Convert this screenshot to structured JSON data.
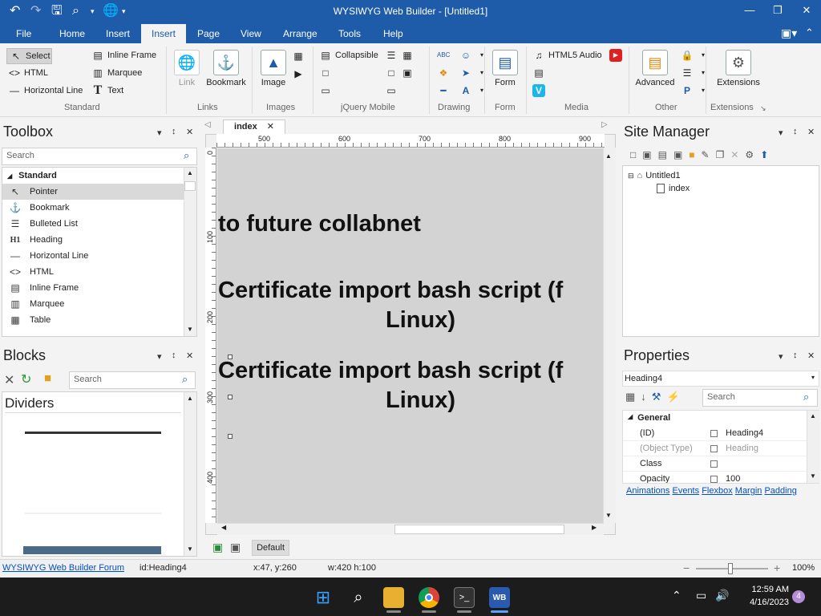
{
  "window": {
    "title": "WYSIWYG Web Builder - [Untitled1]"
  },
  "menu": [
    "File",
    "Home",
    "Insert",
    "Insert",
    "Page",
    "View",
    "Arrange",
    "Tools",
    "Help"
  ],
  "menu_tabs": {
    "file": "File",
    "home": "Home",
    "insert1": "Insert",
    "insert2": "Insert",
    "page": "Page",
    "view": "View",
    "arrange": "Arrange",
    "tools": "Tools",
    "help": "Help"
  },
  "ribbon": {
    "standard": {
      "select": "Select",
      "html": "HTML",
      "hline": "Horizontal Line",
      "iframe": "Inline Frame",
      "marquee": "Marquee",
      "text": "Text",
      "group": "Standard"
    },
    "links": {
      "link": "Link",
      "bookmark": "Bookmark",
      "group": "Links"
    },
    "images": {
      "image": "Image",
      "group": "Images"
    },
    "jquery": {
      "collapsible": "Collapsible",
      "group": "jQuery Mobile"
    },
    "drawing": {
      "group": "Drawing"
    },
    "form": {
      "form": "Form",
      "group": "Form"
    },
    "media": {
      "audio": "HTML5 Audio",
      "group": "Media"
    },
    "other": {
      "advanced": "Advanced",
      "group": "Other"
    },
    "extensions": {
      "extensions": "Extensions",
      "group": "Extensions"
    }
  },
  "toolbox": {
    "title": "Toolbox",
    "search_placeholder": "Search",
    "section": "Standard",
    "items": [
      {
        "icon": "pointer-icon",
        "glyph": "↖",
        "label": "Pointer"
      },
      {
        "icon": "anchor-icon",
        "glyph": "⚓",
        "label": "Bookmark"
      },
      {
        "icon": "bulleted-list-icon",
        "glyph": "☰",
        "label": "Bulleted List"
      },
      {
        "icon": "heading-icon",
        "glyph": "H1",
        "label": "Heading"
      },
      {
        "icon": "horizontal-line-icon",
        "glyph": "—",
        "label": "Horizontal Line"
      },
      {
        "icon": "html-icon",
        "glyph": "<>",
        "label": "HTML"
      },
      {
        "icon": "inline-frame-icon",
        "glyph": "▤",
        "label": "Inline Frame"
      },
      {
        "icon": "marquee-icon",
        "glyph": "▥",
        "label": "Marquee"
      },
      {
        "icon": "table-icon",
        "glyph": "▦",
        "label": "Table"
      }
    ]
  },
  "blocks": {
    "title": "Blocks",
    "search_placeholder": "Search",
    "category": "Dividers"
  },
  "document": {
    "tab": "index",
    "ruler": [
      "500",
      "600",
      "700",
      "800",
      "900"
    ],
    "vruler": [
      "0",
      "100",
      "200",
      "300",
      "400"
    ],
    "headings": [
      "to future collabnet",
      "Certificate import bash script (f",
      "Linux)",
      "Certificate import bash script (f",
      "Linux)"
    ],
    "footer_tab": "Default"
  },
  "site_manager": {
    "title": "Site Manager",
    "root": "Untitled1",
    "page": "index"
  },
  "properties": {
    "title": "Properties",
    "object": "Heading4",
    "search_placeholder": "Search",
    "section": "General",
    "rows": [
      {
        "name": "(ID)",
        "value": "Heading4"
      },
      {
        "name": "(Object Type)",
        "value": "Heading"
      },
      {
        "name": "Class",
        "value": ""
      },
      {
        "name": "Opacity",
        "value": "100"
      }
    ],
    "links": [
      "Animations",
      "Events",
      "Flexbox",
      "Margin",
      "Padding"
    ]
  },
  "status": {
    "forum": "WYSIWYG Web Builder Forum",
    "id": "id:Heading4",
    "pos": "x:47, y:260",
    "size": "w:420 h:100",
    "zoom": "100%"
  },
  "taskbar": {
    "time": "12:59 AM",
    "date": "4/16/2023",
    "badge": "4"
  }
}
